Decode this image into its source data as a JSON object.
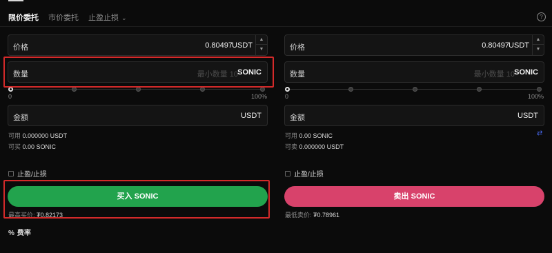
{
  "tabs": [
    {
      "label": "限价委托",
      "active": true
    },
    {
      "label": "市价委托",
      "active": false
    },
    {
      "label": "止盈止损",
      "active": false
    }
  ],
  "help_icon": "?",
  "buy": {
    "price_label": "价格",
    "price_value": "0.80497",
    "price_unit": "USDT",
    "qty_label": "数量",
    "qty_placeholder": "最小数量 10",
    "qty_unit": "SONIC",
    "slider_min": "0",
    "slider_max": "100%",
    "slider_fraction": 0,
    "amount_label": "金额",
    "amount_unit": "USDT",
    "avail_label": "可用",
    "avail_value": "0.000000 USDT",
    "canbuy_label": "可买",
    "canbuy_value": "0.00 SONIC",
    "tpsl_label": "止盈/止损",
    "action_label": "买入 SONIC",
    "best_label": "最高买价:",
    "best_value": "₮0.82173"
  },
  "sell": {
    "price_label": "价格",
    "price_value": "0.80497",
    "price_unit": "USDT",
    "qty_label": "数量",
    "qty_placeholder": "最小数量 10",
    "qty_unit": "SONIC",
    "slider_min": "0",
    "slider_max": "100%",
    "slider_fraction": 0,
    "amount_label": "金额",
    "amount_unit": "USDT",
    "avail_label": "可用",
    "avail_value": "0.00 SONIC",
    "cansell_label": "可卖",
    "cansell_value": "0.000000 USDT",
    "tpsl_label": "止盈/止损",
    "action_label": "卖出 SONIC",
    "best_label": "最低卖价:",
    "best_value": "₮0.78961"
  },
  "fees": {
    "icon": "%",
    "label": "费率"
  },
  "colors": {
    "buy": "#22a34d",
    "sell": "#d8426b",
    "highlight": "#d42a2a",
    "swap": "#4a6cf7"
  }
}
